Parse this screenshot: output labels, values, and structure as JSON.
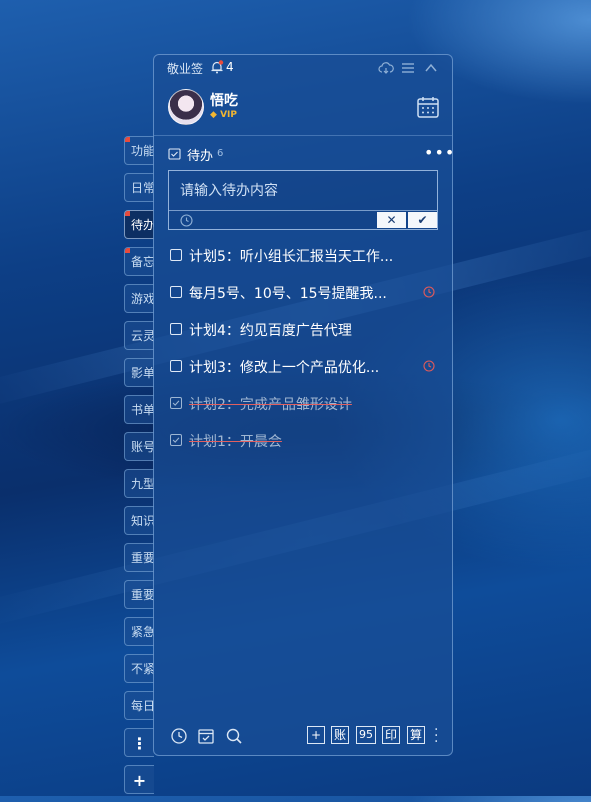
{
  "side_tabs": [
    {
      "label": "功能",
      "flag": true
    },
    {
      "label": "日常",
      "flag": false
    },
    {
      "label": "待办",
      "flag": true,
      "active": true
    },
    {
      "label": "备忘",
      "flag": true
    },
    {
      "label": "游戏",
      "flag": false
    },
    {
      "label": "云灵",
      "flag": false
    },
    {
      "label": "影单",
      "flag": false
    },
    {
      "label": "书单",
      "flag": false
    },
    {
      "label": "账号",
      "flag": false
    },
    {
      "label": "九型",
      "flag": false
    },
    {
      "label": "知识",
      "flag": false
    },
    {
      "label": "重要",
      "flag": false
    },
    {
      "label": "重要",
      "flag": false
    },
    {
      "label": "紧急",
      "flag": false
    },
    {
      "label": "不紧",
      "flag": false
    },
    {
      "label": "每日",
      "flag": false
    }
  ],
  "side_more": "⋮",
  "side_add": "+",
  "titlebar": {
    "app_name": "敬业签",
    "notification_count": "4"
  },
  "user": {
    "name": "悟吃",
    "badge": "VIP"
  },
  "todo": {
    "title": "待办",
    "count": "6",
    "more": "•••"
  },
  "input": {
    "placeholder": "请输入待办内容",
    "cancel": "✕",
    "confirm": "✔"
  },
  "tasks": [
    {
      "text": "计划5：听小组长汇报当天工作...",
      "done": false,
      "reminder": false
    },
    {
      "text": "每月5号、10号、15号提醒我...",
      "done": false,
      "reminder": true
    },
    {
      "text": "计划4：约见百度广告代理",
      "done": false,
      "reminder": false
    },
    {
      "text": "计划3：修改上一个产品优化...",
      "done": false,
      "reminder": true
    },
    {
      "text": "计划2：完成产品雏形设计",
      "done": true,
      "reminder": false
    },
    {
      "text": "计划1：开晨会",
      "done": true,
      "reminder": false
    }
  ],
  "footer_buttons": {
    "add": "+",
    "account": "账",
    "nine": "95",
    "print": "印",
    "calc": "算"
  },
  "colors": {
    "accent": "#1a4e96",
    "flag": "#e84b3c",
    "vip": "#f2b632",
    "reminder": "#e05a5a"
  }
}
